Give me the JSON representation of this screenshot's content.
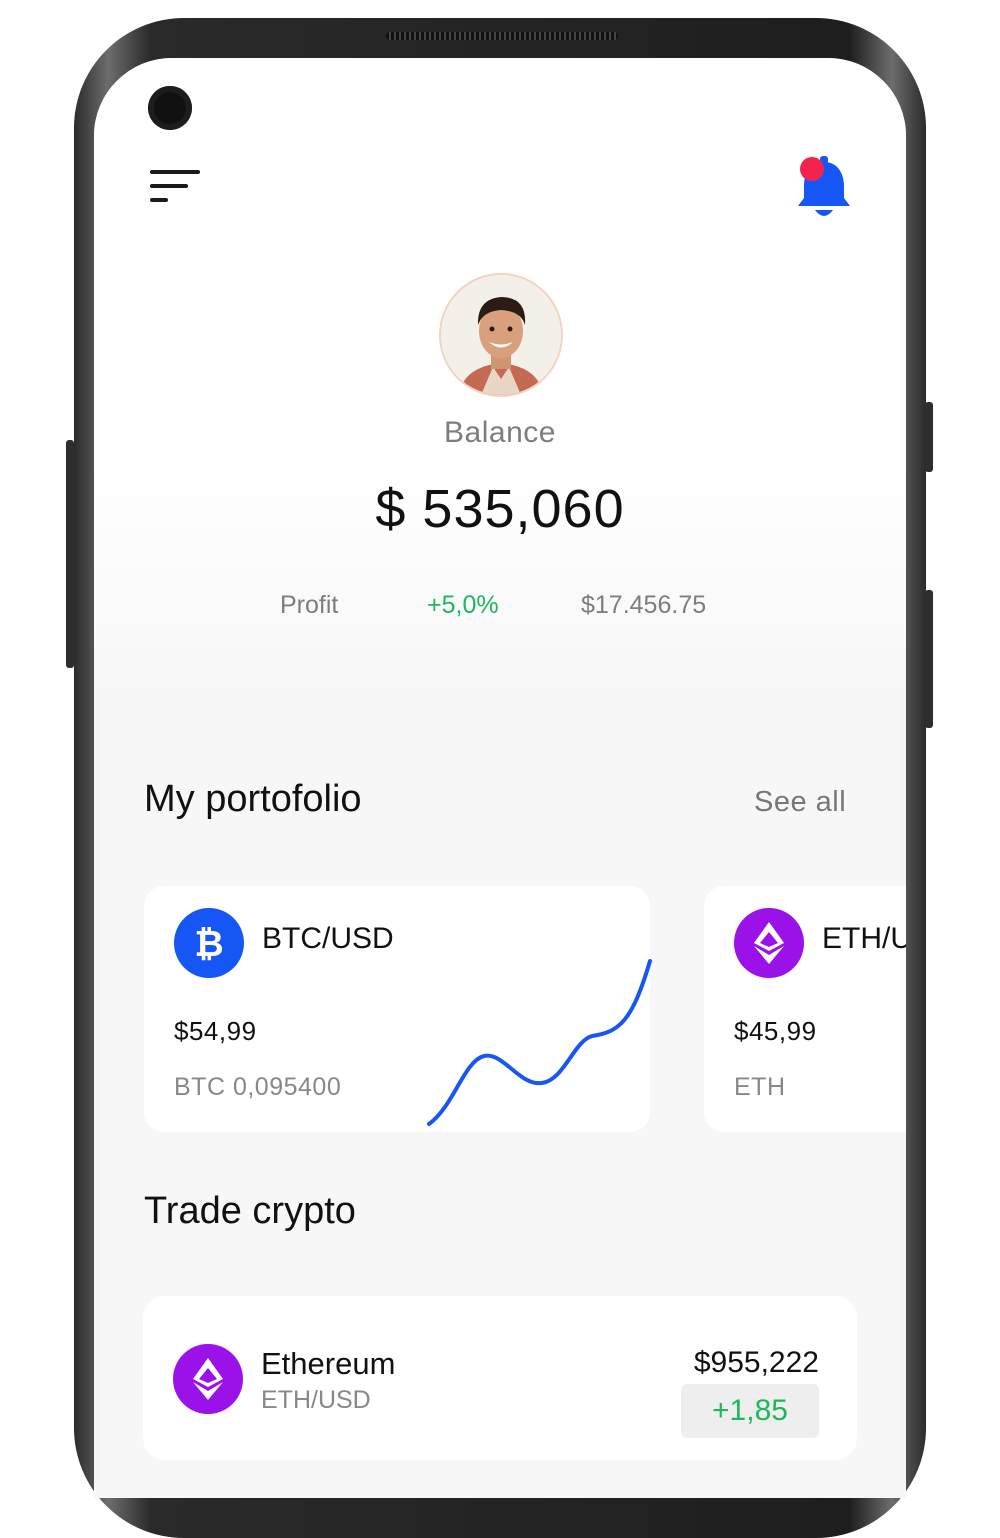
{
  "colors": {
    "accent_blue": "#1656f5",
    "eth_purple": "#9a12e8",
    "profit_green": "#1db85c",
    "notification_red": "#f2244f"
  },
  "header": {
    "menu_icon": "menu-icon",
    "notification_icon": "bell-icon"
  },
  "balance": {
    "label": "Balance",
    "value": "$ 535,060",
    "profit_label": "Profit",
    "profit_percent": "+5,0%",
    "profit_amount": "$17.456.75"
  },
  "portfolio": {
    "title": "My portofolio",
    "see_all": "See all",
    "cards": [
      {
        "pair": "BTC/USD",
        "price": "$54,99",
        "holding": "BTC 0,095400",
        "icon": "bitcoin-icon"
      },
      {
        "pair": "ETH/USD",
        "price": "$45,99",
        "holding": "ETH",
        "icon": "ethereum-icon"
      }
    ]
  },
  "trade": {
    "title": "Trade crypto",
    "items": [
      {
        "name": "Ethereum",
        "pair": "ETH/USD",
        "price": "$955,222",
        "change": "+1,85",
        "icon": "ethereum-icon"
      }
    ]
  }
}
